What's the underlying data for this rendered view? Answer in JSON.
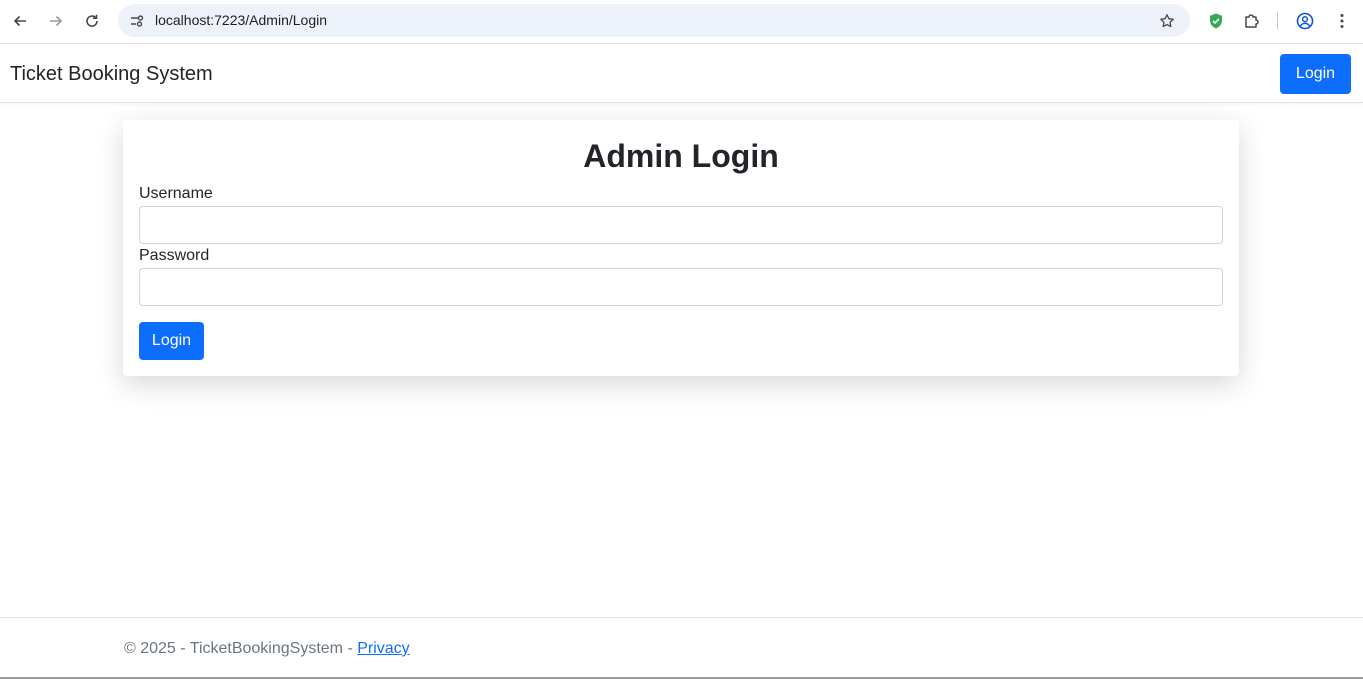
{
  "browser": {
    "url": "localhost:7223/Admin/Login",
    "icons": [
      "back-icon",
      "forward-icon",
      "reload-icon",
      "site-info-icon",
      "star-icon",
      "shield-extension-icon",
      "extensions-puzzle-icon",
      "profile-icon",
      "menu-kebab-icon"
    ]
  },
  "navbar": {
    "brand": "Ticket Booking System",
    "login_label": "Login"
  },
  "login_form": {
    "title": "Admin Login",
    "username_label": "Username",
    "username_value": "",
    "password_label": "Password",
    "password_value": "",
    "submit_label": "Login"
  },
  "footer": {
    "copyright": "© 2025 - TicketBookingSystem - ",
    "privacy_link": "Privacy"
  },
  "colors": {
    "primary": "#0d6efd",
    "text": "#212529",
    "muted": "#6c757d",
    "omnibox_bg": "#edf2fa",
    "shield_green": "#34a853"
  }
}
